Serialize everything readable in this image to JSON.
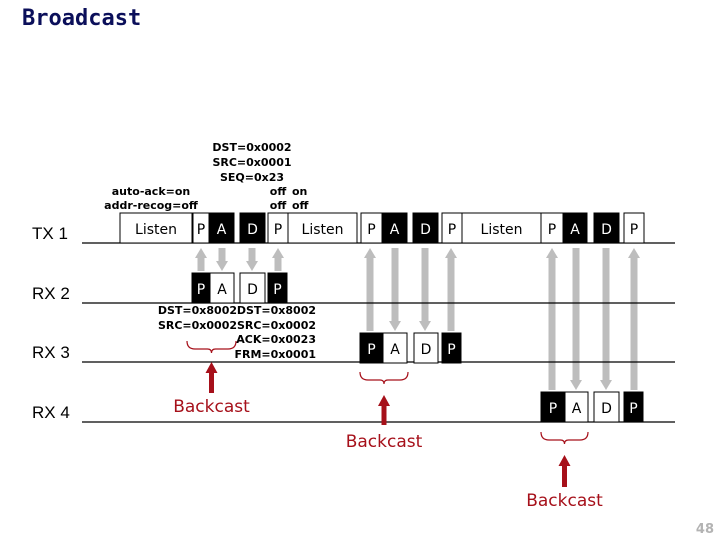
{
  "title": "Broadcast",
  "page_number": "48",
  "colors": {
    "title": "#0b0f5a",
    "frame_dark": "#000000",
    "frame_light": "#ffffff",
    "arrow_gray": "#bdbdbd",
    "backcast_red": "#a6101a"
  },
  "rows": [
    {
      "id": "tx1",
      "label": "TX 1"
    },
    {
      "id": "rx2",
      "label": "RX 2"
    },
    {
      "id": "rx3",
      "label": "RX 3"
    },
    {
      "id": "rx4",
      "label": "RX 4"
    }
  ],
  "tx1_frames": [
    {
      "text": "Listen",
      "style": "light"
    },
    {
      "text": "P",
      "style": "light"
    },
    {
      "text": "A",
      "style": "dark"
    },
    {
      "text": "D",
      "style": "dark"
    },
    {
      "text": "P",
      "style": "light"
    },
    {
      "text": "Listen",
      "style": "light"
    },
    {
      "text": "P",
      "style": "light"
    },
    {
      "text": "A",
      "style": "dark"
    },
    {
      "text": "D",
      "style": "dark"
    },
    {
      "text": "P",
      "style": "light"
    },
    {
      "text": "Listen",
      "style": "light"
    },
    {
      "text": "P",
      "style": "light"
    },
    {
      "text": "A",
      "style": "dark"
    },
    {
      "text": "D",
      "style": "dark"
    },
    {
      "text": "P",
      "style": "light"
    }
  ],
  "rx_frames": [
    {
      "row": "rx2",
      "frames": [
        {
          "text": "P",
          "style": "dark"
        },
        {
          "text": "A",
          "style": "light"
        },
        {
          "text": "D",
          "style": "light"
        },
        {
          "text": "P",
          "style": "dark"
        }
      ]
    },
    {
      "row": "rx3",
      "frames": [
        {
          "text": "P",
          "style": "dark"
        },
        {
          "text": "A",
          "style": "light"
        },
        {
          "text": "D",
          "style": "light"
        },
        {
          "text": "P",
          "style": "dark"
        }
      ]
    },
    {
      "row": "rx4",
      "frames": [
        {
          "text": "P",
          "style": "dark"
        },
        {
          "text": "A",
          "style": "light"
        },
        {
          "text": "D",
          "style": "light"
        },
        {
          "text": "P",
          "style": "dark"
        }
      ]
    }
  ],
  "annotations": {
    "config_initial": [
      "auto-ack=on",
      "addr-recog=off"
    ],
    "data_header": [
      "DST=0x0002",
      "SRC=0x0001",
      "SEQ=0x23"
    ],
    "toggle_col1": [
      "off",
      "off"
    ],
    "toggle_col2": [
      "on",
      "off"
    ],
    "ack_header": [
      "DST=0x8002",
      "SRC=0x0002"
    ],
    "probe_header": [
      "DST=0x8002",
      "SRC=0x0002",
      "ACK=0x0023",
      "FRM=0x0001"
    ]
  },
  "backcast_labels": [
    "Backcast",
    "Backcast",
    "Backcast"
  ],
  "arrow_directions": [
    "up",
    "down",
    "down",
    "up"
  ]
}
